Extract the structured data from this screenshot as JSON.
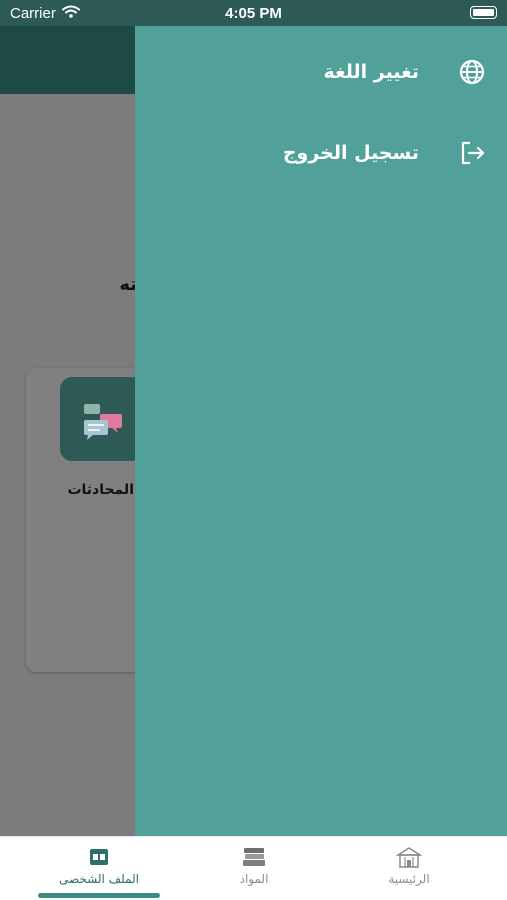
{
  "status_bar": {
    "carrier": "Carrier",
    "time": "4:05 PM"
  },
  "page": {
    "greeting_fragment": "ته",
    "tile_label": "المحادثات"
  },
  "drawer": {
    "items": [
      {
        "label": "تغيير اللغة",
        "icon": "globe-icon"
      },
      {
        "label": "تسجيل الخروج",
        "icon": "logout-icon"
      }
    ]
  },
  "tabbar": {
    "tabs": [
      {
        "label": "الملف الشخصى",
        "icon": "profile-card-icon",
        "active": true
      },
      {
        "label": "المواد",
        "icon": "books-icon",
        "active": false
      },
      {
        "label": "الرئيسية",
        "icon": "school-icon",
        "active": false
      }
    ]
  },
  "colors": {
    "drawer": "#52a09a",
    "header": "#1e4a45",
    "status_bar": "#2e5a56",
    "overlay": "#7c7c7c",
    "active_tab": "#3d8b85"
  }
}
